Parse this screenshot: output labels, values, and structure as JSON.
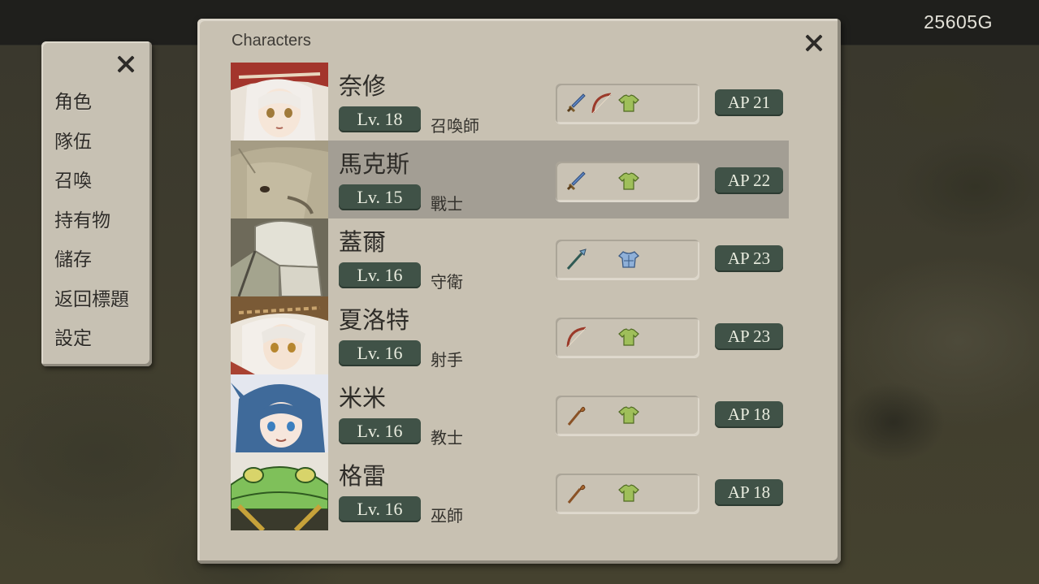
{
  "hud": {
    "gold": "25605G"
  },
  "side_menu": {
    "items": [
      "角色",
      "隊伍",
      "召喚",
      "持有物",
      "儲存",
      "返回標題",
      "設定"
    ]
  },
  "panel": {
    "title": "Characters"
  },
  "characters": [
    {
      "name": "奈修",
      "level": "Lv. 18",
      "class": "召喚師",
      "ap": "AP 21",
      "equipment": [
        "sword-icon",
        "bow-icon",
        "cloth-armor-icon"
      ],
      "selected": false
    },
    {
      "name": "馬克斯",
      "level": "Lv. 15",
      "class": "戰士",
      "ap": "AP 22",
      "equipment": [
        "sword-icon",
        "cloth-armor-icon"
      ],
      "selected": true
    },
    {
      "name": "蓋爾",
      "level": "Lv. 16",
      "class": "守衛",
      "ap": "AP 23",
      "equipment": [
        "spear-icon",
        "plate-armor-icon"
      ],
      "selected": false
    },
    {
      "name": "夏洛特",
      "level": "Lv. 16",
      "class": "射手",
      "ap": "AP 23",
      "equipment": [
        "bow-icon",
        "cloth-armor-icon"
      ],
      "selected": false
    },
    {
      "name": "米米",
      "level": "Lv. 16",
      "class": "教士",
      "ap": "AP 18",
      "equipment": [
        "staff-icon",
        "cloth-armor-icon"
      ],
      "selected": false
    },
    {
      "name": "格雷",
      "level": "Lv. 16",
      "class": "巫師",
      "ap": "AP 18",
      "equipment": [
        "staff-icon",
        "cloth-armor-icon"
      ],
      "selected": false
    }
  ],
  "colors": {
    "panel": "#c8c1b2",
    "badge": "#405247",
    "selected_row": "#a39e94"
  }
}
